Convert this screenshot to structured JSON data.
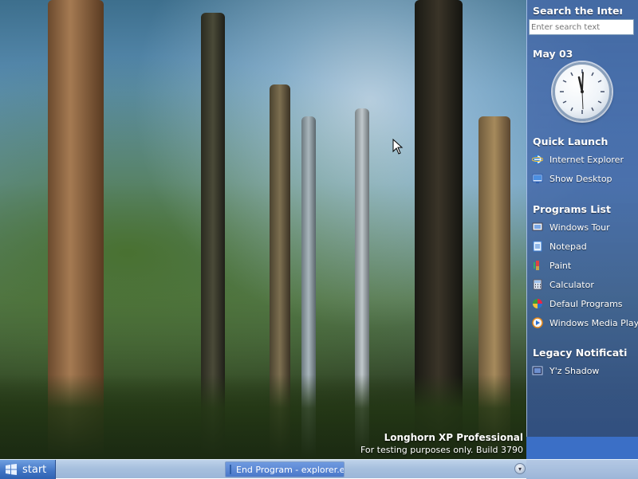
{
  "sidebar": {
    "search_title": "Search the Interi",
    "search_placeholder": "Enter search text",
    "date": "May 03",
    "quick_launch_title": "Quick Launch",
    "quick_launch": [
      {
        "label": "Internet Explorer",
        "icon": "internet-explorer-icon"
      },
      {
        "label": "Show Desktop",
        "icon": "show-desktop-icon"
      }
    ],
    "programs_title": "Programs List",
    "programs": [
      {
        "label": "Windows Tour",
        "icon": "windows-tour-icon"
      },
      {
        "label": "Notepad",
        "icon": "notepad-icon"
      },
      {
        "label": "Paint",
        "icon": "paint-icon"
      },
      {
        "label": "Calculator",
        "icon": "calculator-icon"
      },
      {
        "label": "Defaul Programs",
        "icon": "default-programs-icon"
      },
      {
        "label": "Windows Media Playe",
        "icon": "windows-media-player-icon"
      }
    ],
    "legacy_title": "Legacy Notificati",
    "legacy": [
      {
        "label": "Y'z Shadow",
        "icon": "yz-shadow-icon"
      }
    ]
  },
  "watermark": {
    "line1": "Longhorn XP Professional",
    "line2": "For testing purposes only. Build 3790"
  },
  "taskbar": {
    "start_label": "start",
    "task_label": "End Program - explorer.e"
  },
  "colors": {
    "sidebar_bg": "#4669aa",
    "taskbar_bg": "#a7c0de",
    "start_bg": "#3f73c3"
  }
}
